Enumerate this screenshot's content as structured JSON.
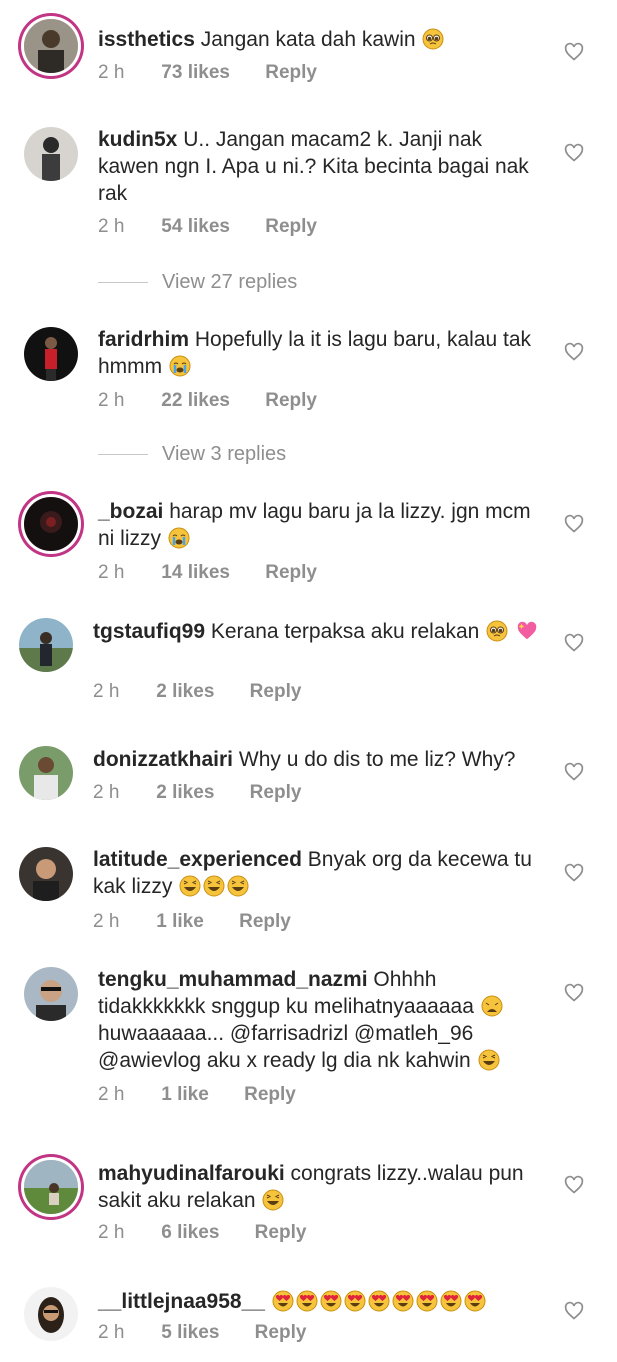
{
  "comments": [
    {
      "username": "issthetics",
      "text": "Jangan kata dah kawin",
      "emoji": "pleading",
      "time": "2 h",
      "likes": "73 likes",
      "reply": "Reply",
      "avatar": "avatar-photo"
    },
    {
      "username": "kudin5x",
      "text": "U.. Jangan macam2 k. Janji nak kawen ngn I. Apa u ni.? Kita becinta bagai nak rak",
      "time": "2 h",
      "likes": "54 likes",
      "reply": "Reply",
      "avatar": "avatar-photo"
    },
    {
      "username": "faridrhim",
      "text": "Hopefully la it is lagu baru, kalau tak hmmm",
      "emoji": "crying",
      "time": "2 h",
      "likes": "22 likes",
      "reply": "Reply",
      "avatar": "avatar-photo"
    },
    {
      "username": "_bozai",
      "text": "harap mv lagu baru ja la lizzy. jgn mcm ni lizzy",
      "emoji": "crying",
      "time": "2 h",
      "likes": "14 likes",
      "reply": "Reply",
      "avatar": "avatar-photo"
    },
    {
      "username": "tgstaufiq99",
      "text": "Kerana terpaksa aku relakan",
      "emoji": "pleading, heart",
      "time": "2 h",
      "likes": "2 likes",
      "reply": "Reply",
      "avatar": "avatar-photo"
    },
    {
      "username": "donizzatkhairi",
      "text": "Why u do dis to me liz? Why?",
      "time": "2 h",
      "likes": "2 likes",
      "reply": "Reply",
      "avatar": "avatar-photo"
    },
    {
      "username": "latitude_experienced",
      "text": "Bnyak org da kecewa tu kak lizzy",
      "emoji": "laughing x3",
      "time": "2 h",
      "likes": "1 like",
      "reply": "Reply",
      "avatar": "avatar-photo"
    },
    {
      "username": "tengku_muhammad_nazmi",
      "text_1": "Ohhhh tidakkkkkkk snggup ku melihatnyaaaaaa",
      "text_2": "huwaaaaaa... @farrisadrizl @matleh_96 @awievlog aku x ready lg dia nk kahwin",
      "emoji": "weary, laughing",
      "time": "2 h",
      "likes": "1 like",
      "reply": "Reply",
      "avatar": "avatar-photo"
    },
    {
      "username": "mahyudinalfarouki",
      "text": "congrats lizzy..walau pun sakit aku relakan",
      "emoji": "laughing",
      "time": "2 h",
      "likes": "6 likes",
      "reply": "Reply",
      "avatar": "avatar-photo"
    },
    {
      "username": "__littlejnaa958__",
      "text": "",
      "emoji": "heart-eyes x9",
      "time": "2 h",
      "likes": "5 likes",
      "reply": "Reply",
      "avatar": "avatar-photo"
    }
  ],
  "view_replies": [
    {
      "label": "View 27 replies"
    },
    {
      "label": "View 3 replies"
    }
  ],
  "colors": {
    "text": "#262626",
    "meta": "#8e8e8e",
    "story_ring": "#c13584"
  },
  "icons": {
    "like": "heart-outline-icon"
  }
}
